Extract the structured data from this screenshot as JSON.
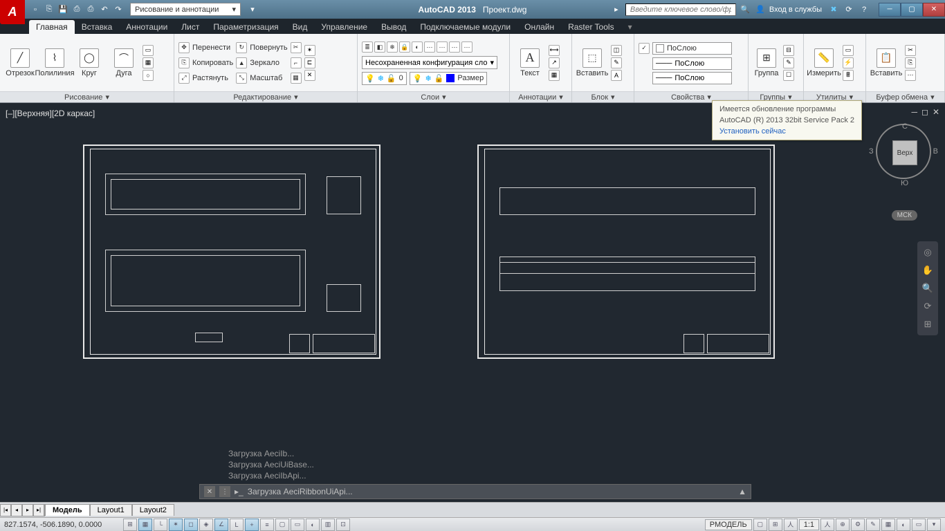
{
  "app": {
    "name": "AutoCAD 2013",
    "file": "Проект.dwg"
  },
  "qat": {
    "workspace": "Рисование и аннотации"
  },
  "search": {
    "placeholder": "Введите ключевое слово/фразу"
  },
  "signin": "Вход в службы",
  "menu": [
    "Главная",
    "Вставка",
    "Аннотации",
    "Лист",
    "Параметризация",
    "Вид",
    "Управление",
    "Вывод",
    "Подключаемые модули",
    "Онлайн",
    "Raster Tools"
  ],
  "ribbon": {
    "draw": {
      "title": "Рисование",
      "items": [
        "Отрезок",
        "Полилиния",
        "Круг",
        "Дуга"
      ]
    },
    "edit": {
      "title": "Редактирование",
      "move": "Перенести",
      "copy": "Копировать",
      "stretch": "Растянуть",
      "rotate": "Повернуть",
      "mirror": "Зеркало",
      "scale": "Масштаб"
    },
    "layers": {
      "title": "Слои",
      "combo": "Несохраненная конфигурация сло",
      "layer0": "0",
      "size": "Размер"
    },
    "anno": {
      "title": "Аннотации",
      "text": "Текст"
    },
    "block": {
      "title": "Блок",
      "insert": "Вставить"
    },
    "props": {
      "title": "Свойства",
      "bylayer": "ПоСлою",
      "bylayer2": "ПоСлою",
      "bylayer3": "ПоСлою"
    },
    "groups": {
      "title": "Группы",
      "group": "Группа"
    },
    "utils": {
      "title": "Утилиты",
      "measure": "Измерить"
    },
    "clip": {
      "title": "Буфер обмена",
      "paste": "Вставить"
    }
  },
  "viewport": {
    "label": "[–][Верхняя][2D каркас]",
    "cube": "Верх",
    "n": "С",
    "s": "Ю",
    "e": "В",
    "w": "З",
    "msk": "МСК"
  },
  "cmd": {
    "h1": "Загрузка AeciIb...",
    "h2": "Загрузка AeciUiBase...",
    "h3": "Загрузка AeciIbApi...",
    "line": "Загрузка AeciRibbonUiApi..."
  },
  "update": {
    "l1": "Имеется обновление программы",
    "l2": "AutoCAD (R) 2013 32bit Service Pack 2",
    "l3": "Установить сейчас"
  },
  "layout": {
    "tabs": [
      "Модель",
      "Layout1",
      "Layout2"
    ]
  },
  "status": {
    "coords": "827.1574, -506.1890, 0.0000",
    "model": "РМОДЕЛЬ",
    "scale": "1:1"
  }
}
